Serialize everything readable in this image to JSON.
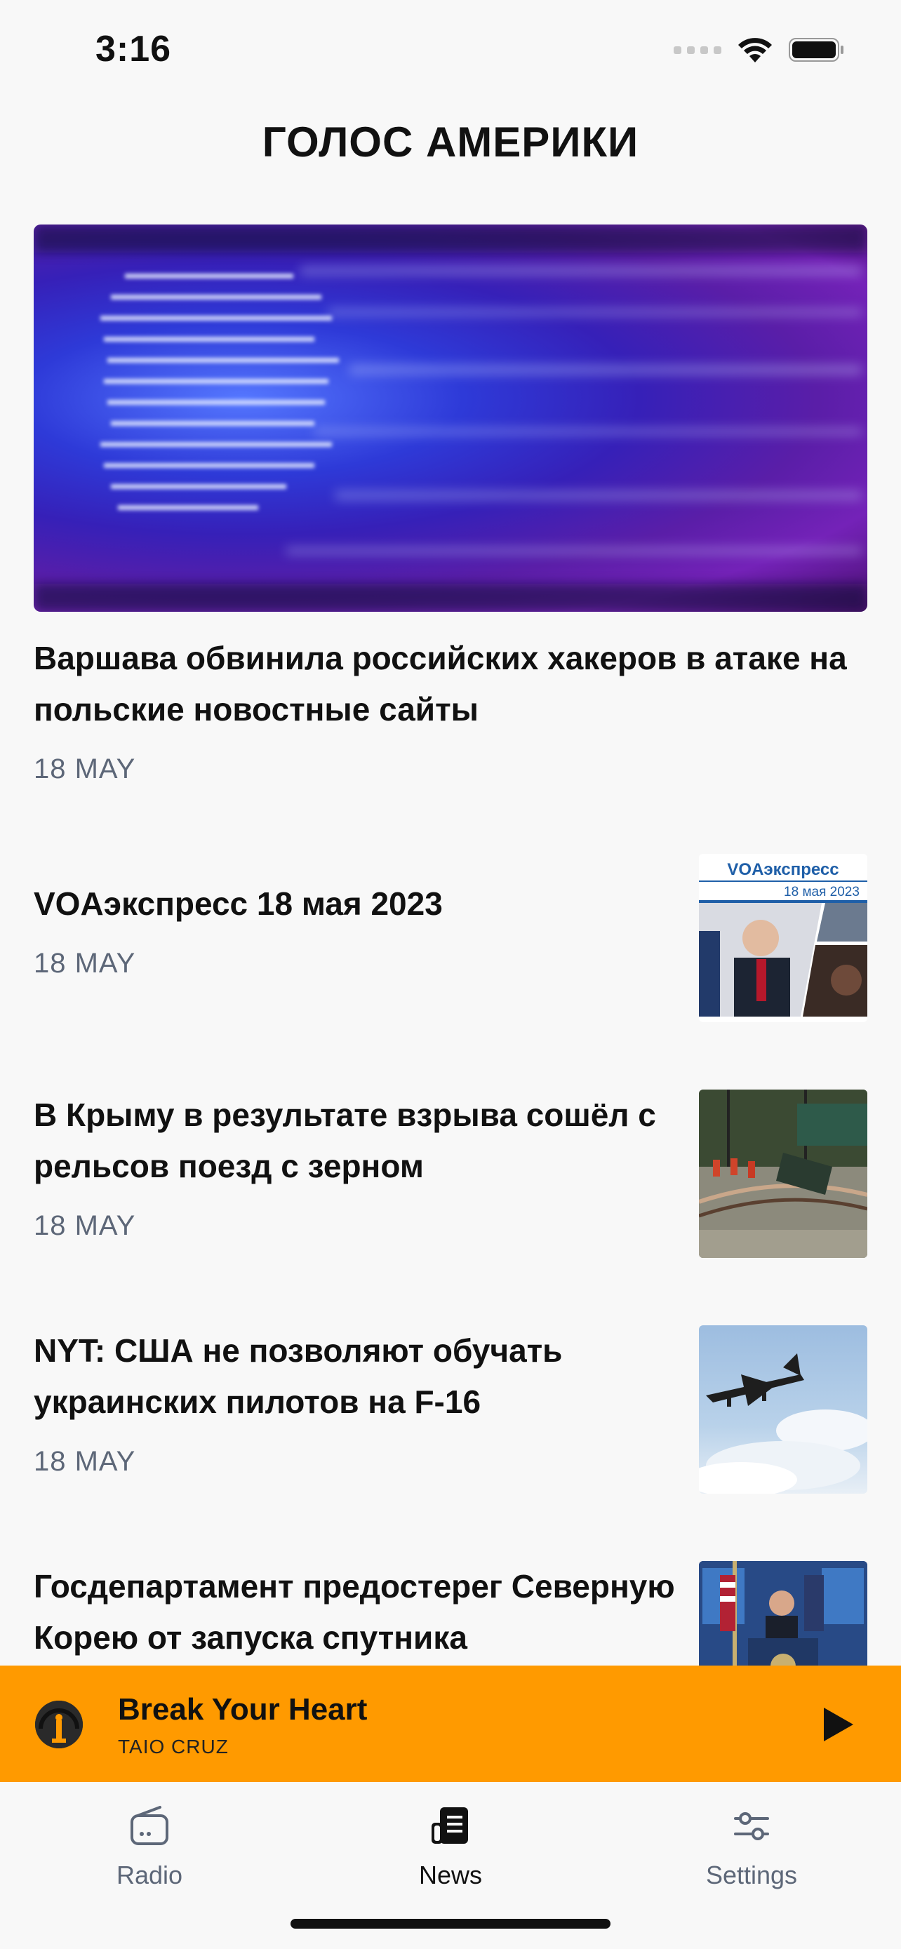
{
  "status_bar": {
    "time": "3:16"
  },
  "header": {
    "title": "ГОЛОС АМЕРИКИ"
  },
  "hero": {
    "title": "Варшава обвинила российских хакеров в атаке на польские новостные сайты",
    "date": "18 MAY",
    "image_icon": "code-screen-image"
  },
  "news": [
    {
      "title": "VOAэкспресс 18 мая 2023",
      "date": "18 MAY",
      "thumb_brand": "VOAэкспресс",
      "thumb_date": "18 мая 2023"
    },
    {
      "title": "В Крыму в результате взрыва сошёл с рельсов поезд с зерном",
      "date": "18 MAY"
    },
    {
      "title": "NYT: США не позволяют обучать украинских пилотов на F-16",
      "date": "18 MAY"
    },
    {
      "title": "Госдепартамент предостерег Северную Корею от запуска спутника",
      "date": ""
    }
  ],
  "player": {
    "title": "Break Your Heart",
    "artist": "TAIO CRUZ",
    "accent": "#ff9a00"
  },
  "tabs": [
    {
      "label": "Radio",
      "icon": "radio-icon"
    },
    {
      "label": "News",
      "icon": "news-icon",
      "active": true
    },
    {
      "label": "Settings",
      "icon": "sliders-icon"
    }
  ]
}
